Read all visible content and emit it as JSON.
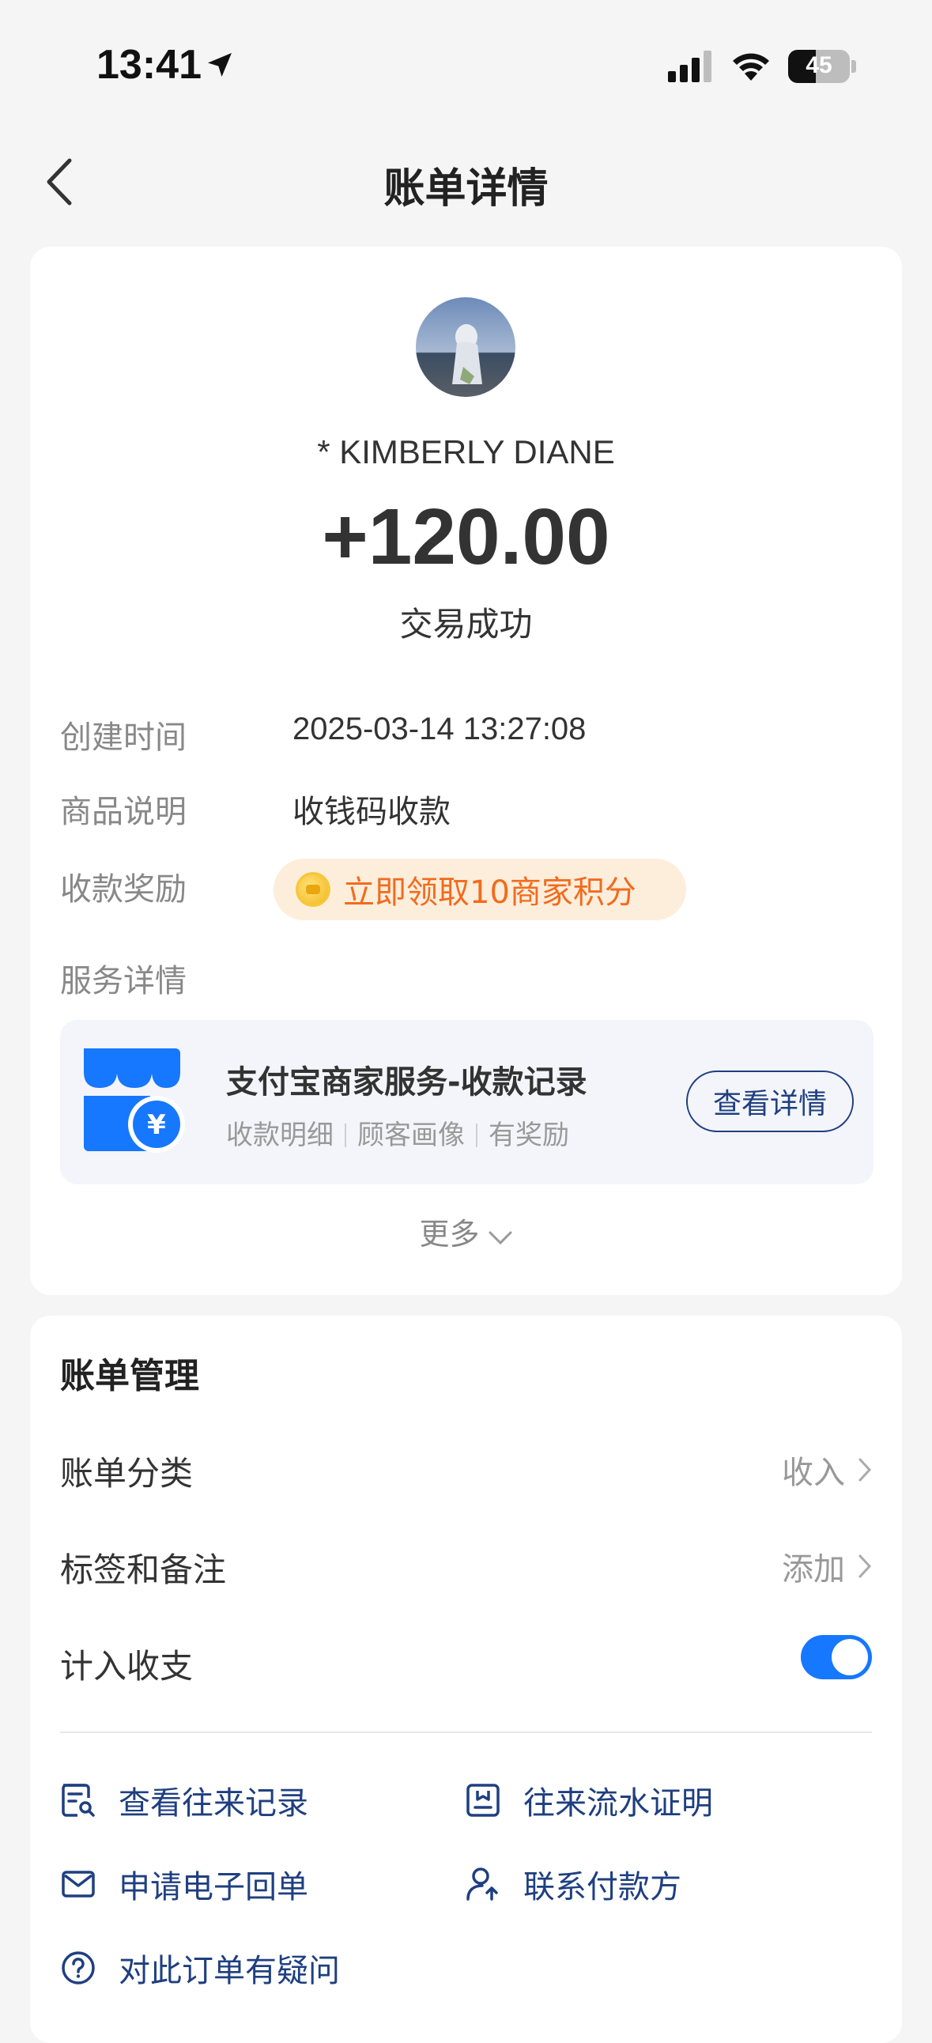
{
  "status_bar": {
    "time": "13:41",
    "battery": "45",
    "battery_level": 0.45
  },
  "nav": {
    "title": "账单详情"
  },
  "transaction": {
    "payer_name": "* KIMBERLY DIANE",
    "amount": "+120.00",
    "status": "交易成功"
  },
  "details": {
    "created_label": "创建时间",
    "created_value": "2025-03-14 13:27:08",
    "product_label": "商品说明",
    "product_value": "收钱码收款",
    "reward_label": "收款奖励",
    "reward_value": "立即领取10商家积分",
    "service_label": "服务详情"
  },
  "service_card": {
    "title": "支付宝商家服务-收款记录",
    "tags": [
      "收款明细",
      "顾客画像",
      "有奖励"
    ],
    "button": "查看详情",
    "symbol": "¥"
  },
  "more": "更多",
  "bill_management": {
    "title": "账单管理",
    "category_label": "账单分类",
    "category_value": "收入",
    "tags_label": "标签和备注",
    "tags_value": "添加",
    "include_label": "计入收支",
    "include_on": true
  },
  "actions": {
    "view_records": "查看往来记录",
    "statement": "往来流水证明",
    "e_receipt": "申请电子回单",
    "contact_payer": "联系付款方",
    "question": "对此订单有疑问"
  },
  "colors": {
    "accent_blue": "#1677ff",
    "link_blue": "#1f3f80",
    "reward_orange": "#f26b1d",
    "reward_bg": "#fdeedc"
  }
}
